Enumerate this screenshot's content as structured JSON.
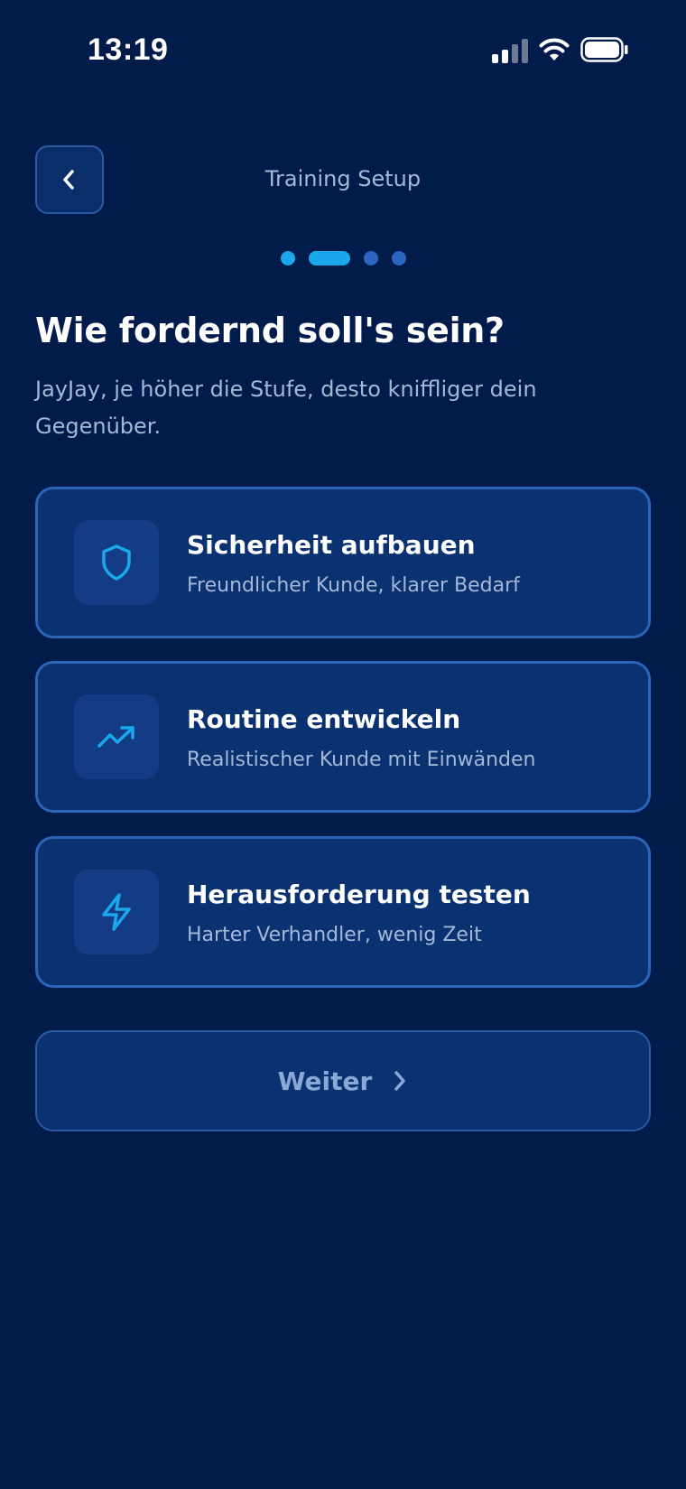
{
  "status_bar": {
    "time": "13:19"
  },
  "header": {
    "title": "Training Setup",
    "back_icon": "chevron-left-icon"
  },
  "steps": {
    "total": 4,
    "current": 2
  },
  "content": {
    "title": "Wie fordernd soll's sein?",
    "subtitle": "JayJay, je höher die Stufe, desto kniffliger dein Gegenüber."
  },
  "options": [
    {
      "title": "Sicherheit aufbauen",
      "description": "Freundlicher Kunde, klarer Bedarf",
      "icon": "shield-icon"
    },
    {
      "title": "Routine entwickeln",
      "description": "Realistischer Kunde mit Einwänden",
      "icon": "trending-up-icon"
    },
    {
      "title": "Herausforderung testen",
      "description": "Harter Verhandler, wenig Zeit",
      "icon": "lightning-icon"
    }
  ],
  "next_button": {
    "label": "Weiter",
    "icon": "chevron-right-icon"
  },
  "colors": {
    "background": "#011b4b",
    "card": "#0a3170",
    "card_border": "#2b64b8",
    "accent": "#1aa7ec",
    "muted_text": "#a4b8d8"
  }
}
